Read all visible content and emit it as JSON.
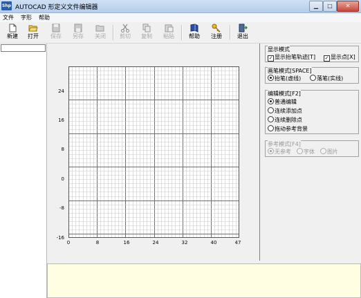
{
  "window": {
    "title": "AUTOCAD 形定义文件编辑器",
    "icon_label": "Shp",
    "minimize": "▁",
    "maximize": "□",
    "close": "✕"
  },
  "menu": [
    {
      "label": "文件"
    },
    {
      "label": "字形"
    },
    {
      "label": "帮助"
    }
  ],
  "toolbar": [
    {
      "label": "新建",
      "icon": "new-file-icon",
      "enabled": true
    },
    {
      "label": "打开",
      "icon": "open-folder-icon",
      "enabled": true
    },
    {
      "label": "保存",
      "icon": "save-icon",
      "enabled": false
    },
    {
      "label": "另存",
      "icon": "save-as-icon",
      "enabled": false
    },
    {
      "label": "关闭",
      "icon": "close-folder-icon",
      "enabled": false
    },
    {
      "label": "剪切",
      "icon": "scissors-icon",
      "enabled": false
    },
    {
      "label": "复制",
      "icon": "copy-icon",
      "enabled": false
    },
    {
      "label": "粘贴",
      "icon": "paste-icon",
      "enabled": false
    },
    {
      "label": "帮助",
      "icon": "help-book-icon",
      "enabled": true
    },
    {
      "label": "注册",
      "icon": "key-icon",
      "enabled": true
    },
    {
      "label": "退出",
      "icon": "exit-icon",
      "enabled": true
    }
  ],
  "grid": {
    "y_ticks": [
      "24",
      "16",
      "8",
      "0",
      "-8",
      "-16"
    ],
    "x_ticks": [
      "0",
      "8",
      "16",
      "24",
      "32",
      "40",
      "47"
    ],
    "x_range": [
      0,
      47
    ],
    "y_range": [
      -16,
      24
    ],
    "color_minor": "#c8c8c8",
    "color_major": "#6e6e6e"
  },
  "display_mode": {
    "title": "显示模式",
    "show_pen_trace": {
      "label": "显示抬笔轨迹[T]",
      "checked": true
    },
    "show_points": {
      "label": "显示点[X]",
      "checked": true
    }
  },
  "pen_mode": {
    "title": "画笔模式[SPACE]",
    "options": [
      {
        "label": "抬笔(虚线)",
        "selected": true
      },
      {
        "label": "落笔(实线)",
        "selected": false
      }
    ]
  },
  "edit_mode": {
    "title": "编辑模式[F2]",
    "options": [
      {
        "label": "普通编辑",
        "selected": true
      },
      {
        "label": "连续添加点",
        "selected": false
      },
      {
        "label": "连续删除点",
        "selected": false
      },
      {
        "label": "拖动参考背景",
        "selected": false
      }
    ]
  },
  "ref_mode": {
    "title": "参考模式[F4]",
    "enabled": false,
    "options": [
      {
        "label": "无参考",
        "selected": true
      },
      {
        "label": "字体",
        "selected": false
      },
      {
        "label": "图片",
        "selected": false
      }
    ]
  }
}
